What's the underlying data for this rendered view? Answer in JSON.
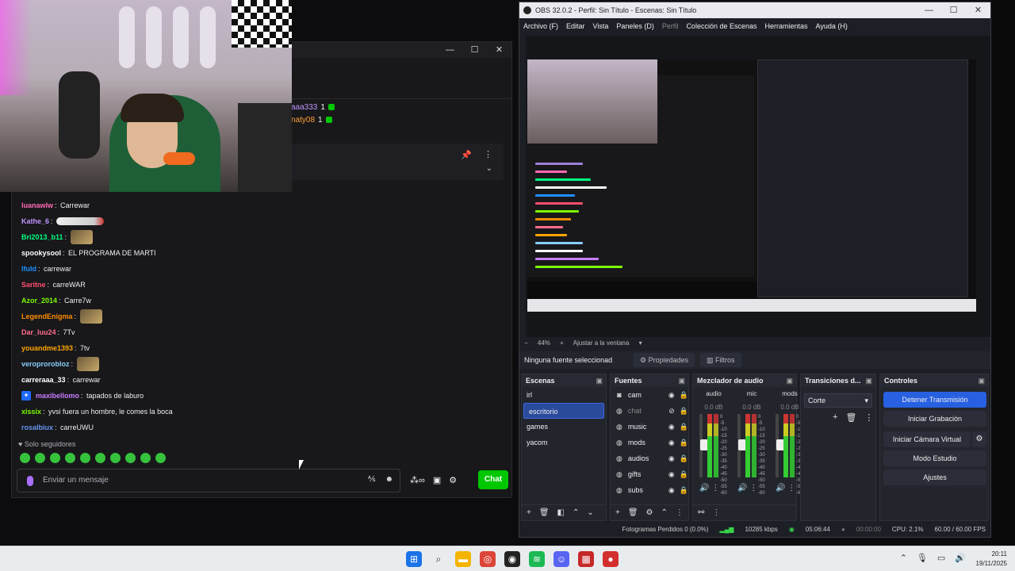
{
  "chat": {
    "hype": [
      {
        "name": "aaa333",
        "count": "1"
      },
      {
        "name": "naty08",
        "count": "1"
      }
    ],
    "messages": [
      {
        "user": "luanawlw",
        "color": "#ff69b4",
        "text": "Carrewar",
        "emote": ""
      },
      {
        "user": "Kathe_6",
        "color": "#bf94ff",
        "text": "",
        "emote": "cigar-emote"
      },
      {
        "user": "Bri2013_b11",
        "color": "#00ff7f",
        "text": "",
        "emote": "face-emote"
      },
      {
        "user": "spookysool",
        "color": "#ffffff",
        "text": "EL PROGRAMA DE MARTI",
        "emote": ""
      },
      {
        "user": "lfuld",
        "color": "#1e90ff",
        "text": "carrewar",
        "emote": ""
      },
      {
        "user": "Saritne",
        "color": "#ff4d6d",
        "text": "carreWAR",
        "emote": ""
      },
      {
        "user": "Azor_2014",
        "color": "#7cfc00",
        "text": "Carre7w",
        "emote": ""
      },
      {
        "user": "LegendEnigma",
        "color": "#ff8c00",
        "text": "",
        "emote": "face-emote"
      },
      {
        "user": "Dar_luu24",
        "color": "#ff6b8a",
        "text": "7Tv",
        "emote": ""
      },
      {
        "user": "youandme1393",
        "color": "#ffa500",
        "text": "7tv",
        "emote": ""
      },
      {
        "user": "veroprorobloz",
        "color": "#87cefa",
        "text": "",
        "emote": "face-emote"
      },
      {
        "user": "carreraaa_33",
        "color": "#ffffff",
        "text": "carrewar",
        "emote": ""
      },
      {
        "user": "maxibellomo",
        "color": "#c77dff",
        "text": "tapados de laburo",
        "emote": ""
      },
      {
        "user": "xissix",
        "color": "#7cfc00",
        "text": "yvsi fuera un hombre, le comes la boca",
        "emote": ""
      },
      {
        "user": "rosalbiux",
        "color": "#6495ed",
        "text": "carreUWU",
        "emote": ""
      }
    ],
    "followers_only": "Solo seguidores",
    "input_placeholder": "Enviar un mensaje",
    "send_label": "Chat"
  },
  "obs": {
    "title": "OBS 32.0.2 - Perfil: Sin Título - Escenas: Sin Título",
    "menu": [
      "Archivo (F)",
      "Editar",
      "Vista",
      "Paneles (D)",
      "Perfil",
      "Colección de Escenas",
      "Herramientas",
      "Ayuda (H)"
    ],
    "zoom": "44%",
    "fit_label": "Ajustar a la ventana",
    "no_source": "Ninguna fuente seleccionad",
    "properties_label": "Propiedades",
    "filters_label": "Filtros",
    "scenes_title": "Escenas",
    "scenes": [
      "irl",
      "escritorio",
      "games",
      "yacom"
    ],
    "active_scene_index": 1,
    "sources_title": "Fuentes",
    "sources": [
      {
        "name": "cam",
        "icon": "camera-icon",
        "hidden": false
      },
      {
        "name": "chat",
        "icon": "globe-icon",
        "hidden": true
      },
      {
        "name": "music",
        "icon": "globe-icon",
        "hidden": false
      },
      {
        "name": "mods",
        "icon": "globe-icon",
        "hidden": false
      },
      {
        "name": "audios",
        "icon": "globe-icon",
        "hidden": false
      },
      {
        "name": "gifts",
        "icon": "globe-icon",
        "hidden": false
      },
      {
        "name": "subs",
        "icon": "globe-icon",
        "hidden": false
      }
    ],
    "mixer_title": "Mezclador de audio",
    "mixer": [
      {
        "name": "audio",
        "db": "0.0 dB"
      },
      {
        "name": "mic",
        "db": "0.0 dB"
      },
      {
        "name": "mods",
        "db": "0.0 dB"
      }
    ],
    "mixer_scale": [
      "0",
      "-5",
      "-10",
      "-15",
      "-20",
      "-25",
      "-30",
      "-35",
      "-40",
      "-45",
      "-50",
      "-55",
      "-60"
    ],
    "transitions_title": "Transiciones d...",
    "transition_value": "Corte",
    "controls_title": "Controles",
    "controls": [
      "Detener Transmisión",
      "Iniciar Grabación",
      "Iniciar Cámara Virtual",
      "Modo Estudio",
      "Ajustes"
    ],
    "status": {
      "dropped": "Fotogramas Perdidos 0 (0.0%)",
      "kbps": "10285 kbps",
      "live_time": "05:06:44",
      "rec_time": "00:00:00",
      "cpu": "CPU: 2.1%",
      "fps": "60.00 / 60.00 FPS"
    }
  },
  "taskbar": {
    "time": "20:11",
    "date": "19/11/2025"
  },
  "colors": {
    "twitch_purple": "#a970ff",
    "send_green": "#00c700",
    "obs_accent": "#2760e0"
  }
}
